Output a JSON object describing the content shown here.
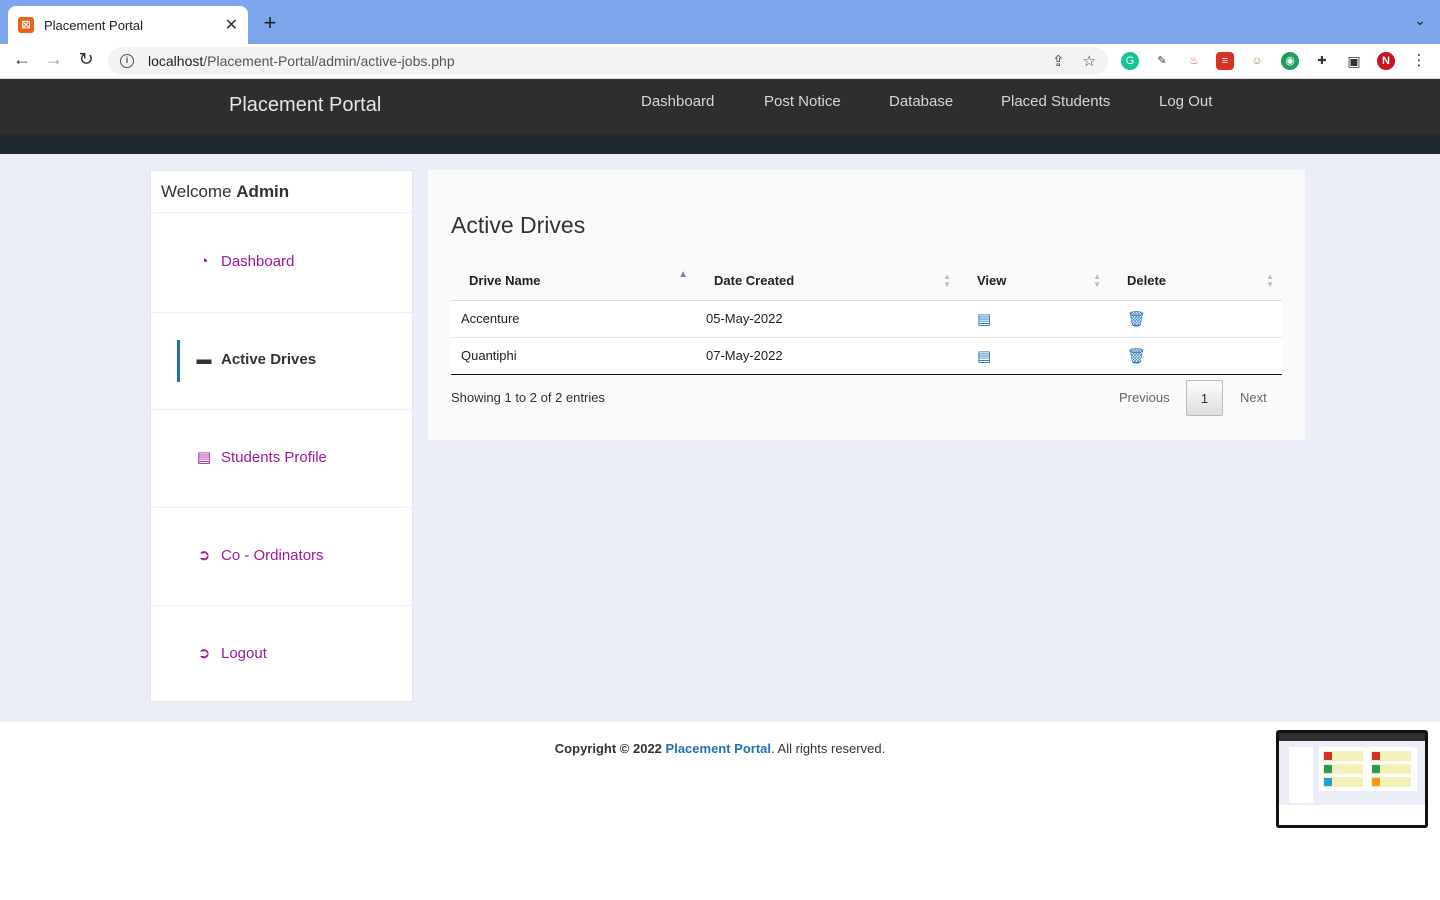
{
  "browser": {
    "tab_title": "Placement Portal",
    "url_host": "localhost",
    "url_path": "/Placement-Portal/admin/active-jobs.php",
    "profile_initial": "N"
  },
  "navbar": {
    "brand": "Placement Portal",
    "links": [
      "Dashboard",
      "Post Notice",
      "Database",
      "Placed Students",
      "Log Out"
    ]
  },
  "sidebar": {
    "welcome_prefix": "Welcome",
    "welcome_user": "Admin",
    "items": [
      {
        "label": "Dashboard",
        "icon": "dashboard-icon"
      },
      {
        "label": "Active Drives",
        "icon": "briefcase-icon",
        "active": true
      },
      {
        "label": "Students Profile",
        "icon": "id-card-icon"
      },
      {
        "label": "Co - Ordinators",
        "icon": "circle-arrow-icon"
      },
      {
        "label": "Logout",
        "icon": "circle-arrow-icon"
      }
    ]
  },
  "main": {
    "title": "Active Drives",
    "table": {
      "headers": [
        "Drive Name",
        "Date Created",
        "View",
        "Delete"
      ],
      "rows": [
        {
          "drive": "Accenture",
          "date": "05-May-2022"
        },
        {
          "drive": "Quantiphi",
          "date": "07-May-2022"
        }
      ]
    },
    "info": "Showing 1 to 2 of 2 entries",
    "pagination": {
      "previous": "Previous",
      "page": "1",
      "next": "Next"
    }
  },
  "footer": {
    "prefix": "Copyright © 2022",
    "brand": "Placement Portal",
    "suffix": ". All rights reserved."
  },
  "colors": {
    "navbar": "#302d2e",
    "sidebar_link": "#a0189b",
    "accent": "#1f72b8",
    "page_bg": "#ebeef7"
  }
}
